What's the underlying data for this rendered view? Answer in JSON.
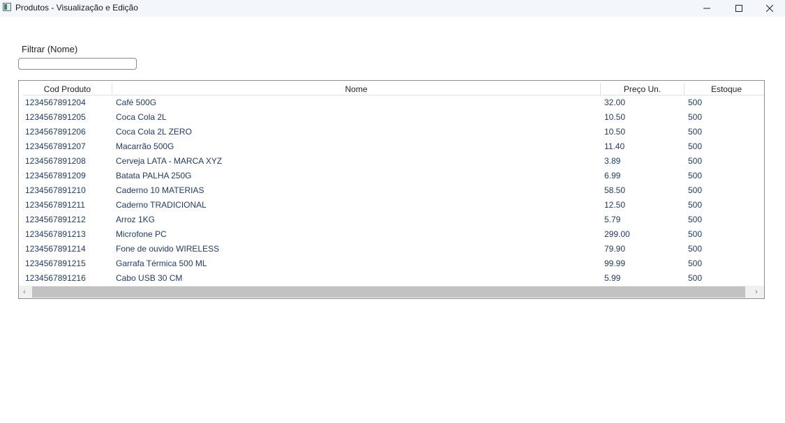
{
  "window": {
    "title": "Produtos - Visualização e Edição",
    "controls": [
      "minimize-icon",
      "maximize-icon",
      "close-icon"
    ]
  },
  "filter": {
    "label": "Filtrar (Nome)",
    "value": "",
    "placeholder": ""
  },
  "grid": {
    "columns": [
      "Cod Produto",
      "Nome",
      "Preço Un.",
      "Estoque"
    ],
    "rows": [
      [
        "1234567891204",
        "Café 500G",
        "32.00",
        "500"
      ],
      [
        "1234567891205",
        "Coca Cola 2L",
        "10.50",
        "500"
      ],
      [
        "1234567891206",
        "Coca Cola 2L ZERO",
        "10.50",
        "500"
      ],
      [
        "1234567891207",
        "Macarrão 500G",
        "11.40",
        "500"
      ],
      [
        "1234567891208",
        "Cerveja LATA - MARCA XYZ",
        "3.89",
        "500"
      ],
      [
        "1234567891209",
        "Batata PALHA 250G",
        "6.99",
        "500"
      ],
      [
        "1234567891210",
        "Caderno 10 MATERIAS",
        "58.50",
        "500"
      ],
      [
        "1234567891211",
        "Caderno TRADICIONAL",
        "12.50",
        "500"
      ],
      [
        "1234567891212",
        "Arroz 1KG",
        "5.79",
        "500"
      ],
      [
        "1234567891213",
        "Microfone PC",
        "299.00",
        "500"
      ],
      [
        "1234567891214",
        "Fone de ouvido WIRELESS",
        "79.90",
        "500"
      ],
      [
        "1234567891215",
        "Garrafa Térmica 500 ML",
        "99.99",
        "500"
      ],
      [
        "1234567891216",
        "Cabo USB 30 CM",
        "5.99",
        "500"
      ]
    ],
    "scrollbar": {
      "left_arrow": "‹",
      "right_arrow": "›"
    }
  },
  "colors": {
    "cell_text": "#1f3a6b",
    "titlebar_bg": "#f3f6fb",
    "scroll_thumb": "#c2c2c2"
  }
}
